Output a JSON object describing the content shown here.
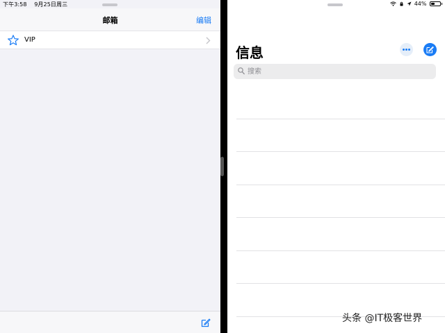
{
  "status_bar": {
    "time": "下午3:58",
    "date": "9月25日周三",
    "battery_percent": "44%",
    "battery_level": 0.44
  },
  "mail": {
    "title": "邮箱",
    "edit_label": "编辑",
    "rows": [
      {
        "label": "VIP",
        "icon": "star-icon"
      }
    ],
    "compose_icon": "compose-icon"
  },
  "messages": {
    "title": "信息",
    "search": {
      "placeholder": "搜索",
      "value": ""
    },
    "more_icon": "ellipsis-icon",
    "compose_icon": "compose-icon"
  },
  "watermark": "头条 @IT极客世界",
  "colors": {
    "accent": "#1a7cf5",
    "sidebar_bg": "#f2f2f7",
    "search_bg": "#ececed"
  }
}
